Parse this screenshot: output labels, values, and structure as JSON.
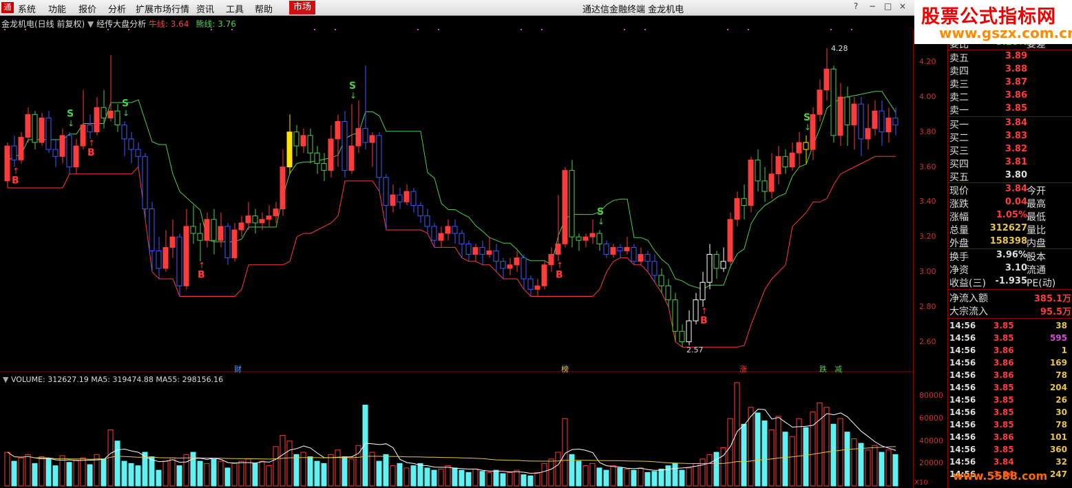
{
  "menubar": {
    "logo": "通",
    "items": [
      "系统",
      "功能",
      "报价",
      "分析",
      "扩展市场行情",
      "资讯",
      "工具",
      "帮助"
    ],
    "market_tab": "市场",
    "title": "通达信金融终端",
    "stock": "金龙机电",
    "window_buttons": [
      "?",
      "−",
      "□",
      "×"
    ]
  },
  "watermark": {
    "line1": "股票公式指标网",
    "line2": "www.gszx.com.cn",
    "bottom": "www.5588.com"
  },
  "chart_header": {
    "name": "金龙机电(日线 前复权)",
    "indicator": "经传大盘分析",
    "bull_label": "牛线:",
    "bull_value": "3.64",
    "bear_label": "熊线:",
    "bear_value": "3.76"
  },
  "volume_header": {
    "text": "VOLUME: 312627.19  MA5: 319474.88  MA55: 298156.16"
  },
  "events": [
    {
      "label": "财",
      "color": "#4aa3ff",
      "pos": 340
    },
    {
      "label": "榜",
      "color": "#e6c64a",
      "pos": 815
    },
    {
      "label": "涨",
      "color": "#ff3b3b",
      "pos": 1074
    },
    {
      "label": "跌",
      "color": "#4cd04c",
      "pos": 1190
    },
    {
      "label": "减",
      "color": "#4cd04c",
      "pos": 1212
    }
  ],
  "chart_data": {
    "type": "candlestick",
    "price_axis": {
      "min": 2.5,
      "max": 4.35,
      "ticks": [
        "4.20",
        "4.00",
        "3.80",
        "3.60",
        "3.40",
        "3.20",
        "3.00",
        "2.80",
        "2.60"
      ]
    },
    "volume_axis": {
      "max": 95000,
      "ticks": [
        "80000",
        "60000",
        "40000",
        "20000"
      ],
      "unit_label": "X10"
    },
    "high_label": "4.28",
    "low_label": "2.57",
    "signals": [
      {
        "type": "B",
        "index": 1
      },
      {
        "type": "S",
        "index": 9
      },
      {
        "type": "B",
        "index": 12
      },
      {
        "type": "S",
        "index": 17
      },
      {
        "type": "B",
        "index": 28
      },
      {
        "type": "S",
        "index": 50
      },
      {
        "type": "B",
        "index": 80
      },
      {
        "type": "S",
        "index": 86
      },
      {
        "type": "B",
        "index": 101
      },
      {
        "type": "S",
        "index": 116
      }
    ],
    "candles": [
      [
        3.52,
        3.72,
        3.74,
        3.48
      ],
      [
        3.72,
        3.64,
        3.78,
        3.6
      ],
      [
        3.64,
        3.77,
        3.8,
        3.62
      ],
      [
        3.77,
        3.9,
        3.94,
        3.74
      ],
      [
        3.9,
        3.74,
        3.92,
        3.7
      ],
      [
        3.74,
        3.88,
        3.91,
        3.72
      ],
      [
        3.88,
        3.7,
        3.92,
        3.68
      ],
      [
        3.7,
        3.66,
        3.76,
        3.6
      ],
      [
        3.66,
        3.78,
        3.82,
        3.62
      ],
      [
        3.78,
        3.6,
        3.8,
        3.56
      ],
      [
        3.6,
        3.72,
        3.76,
        3.56
      ],
      [
        3.72,
        3.84,
        4.04,
        3.7
      ],
      [
        3.84,
        3.8,
        3.9,
        3.76
      ],
      [
        3.8,
        3.94,
        4.0,
        3.78
      ],
      [
        3.94,
        3.88,
        4.04,
        3.82
      ],
      [
        3.88,
        3.92,
        4.24,
        3.86
      ],
      [
        3.92,
        3.84,
        3.96,
        3.8
      ],
      [
        3.84,
        3.76,
        3.86,
        3.66
      ],
      [
        3.76,
        3.7,
        3.8,
        3.62
      ],
      [
        3.7,
        3.66,
        3.74,
        3.6
      ],
      [
        3.66,
        3.36,
        3.68,
        3.3
      ],
      [
        3.36,
        3.12,
        3.4,
        3.0
      ],
      [
        3.12,
        3.02,
        3.2,
        2.96
      ],
      [
        3.02,
        3.14,
        3.24,
        3.0
      ],
      [
        3.14,
        3.2,
        3.3,
        3.08
      ],
      [
        3.2,
        2.92,
        3.22,
        2.86
      ],
      [
        2.92,
        3.26,
        3.36,
        2.9
      ],
      [
        3.26,
        3.22,
        3.38,
        3.16
      ],
      [
        3.22,
        3.18,
        3.28,
        3.06
      ],
      [
        3.18,
        3.3,
        3.34,
        3.14
      ],
      [
        3.3,
        3.18,
        3.36,
        3.1
      ],
      [
        3.18,
        3.26,
        3.34,
        3.14
      ],
      [
        3.26,
        3.08,
        3.28,
        3.04
      ],
      [
        3.08,
        3.24,
        3.28,
        3.06
      ],
      [
        3.24,
        3.28,
        3.32,
        3.2
      ],
      [
        3.28,
        3.32,
        3.4,
        3.24
      ],
      [
        3.32,
        3.28,
        3.36,
        3.22
      ],
      [
        3.28,
        3.3,
        3.34,
        3.24
      ],
      [
        3.3,
        3.32,
        3.38,
        3.26
      ],
      [
        3.32,
        3.36,
        3.4,
        3.28
      ],
      [
        3.36,
        3.6,
        3.7,
        3.32
      ],
      [
        3.6,
        3.8,
        3.9,
        3.56
      ],
      [
        3.8,
        3.72,
        3.84,
        3.66
      ],
      [
        3.72,
        3.78,
        3.82,
        3.68
      ],
      [
        3.78,
        3.68,
        3.82,
        3.62
      ],
      [
        3.68,
        3.62,
        3.72,
        3.56
      ],
      [
        3.62,
        3.58,
        3.68,
        3.52
      ],
      [
        3.58,
        3.76,
        3.84,
        3.54
      ],
      [
        3.76,
        3.86,
        3.9,
        3.6
      ],
      [
        3.86,
        3.58,
        3.92,
        3.54
      ],
      [
        3.58,
        3.72,
        3.96,
        3.56
      ],
      [
        3.72,
        3.82,
        3.98,
        3.68
      ],
      [
        3.82,
        3.74,
        4.18,
        3.7
      ],
      [
        3.74,
        3.78,
        3.8,
        3.6
      ],
      [
        3.78,
        3.54,
        3.8,
        3.46
      ],
      [
        3.54,
        3.38,
        3.56,
        3.24
      ],
      [
        3.38,
        3.44,
        3.5,
        3.34
      ],
      [
        3.44,
        3.4,
        3.48,
        3.36
      ],
      [
        3.4,
        3.46,
        3.5,
        3.38
      ],
      [
        3.46,
        3.38,
        3.48,
        3.34
      ],
      [
        3.38,
        3.32,
        3.4,
        3.28
      ],
      [
        3.32,
        3.26,
        3.36,
        3.22
      ],
      [
        3.26,
        3.18,
        3.28,
        3.14
      ],
      [
        3.18,
        3.22,
        3.26,
        3.14
      ],
      [
        3.22,
        3.26,
        3.3,
        3.18
      ],
      [
        3.26,
        3.22,
        3.3,
        3.16
      ],
      [
        3.22,
        3.16,
        3.24,
        3.08
      ],
      [
        3.16,
        3.1,
        3.18,
        3.06
      ],
      [
        3.1,
        3.14,
        3.16,
        3.06
      ],
      [
        3.14,
        3.1,
        3.18,
        3.04
      ],
      [
        3.1,
        3.12,
        3.2,
        3.08
      ],
      [
        3.12,
        3.06,
        3.16,
        3.0
      ],
      [
        3.06,
        3.02,
        3.08,
        2.96
      ],
      [
        3.02,
        3.04,
        3.08,
        2.98
      ],
      [
        3.04,
        3.08,
        3.12,
        3.0
      ],
      [
        3.08,
        2.96,
        3.1,
        2.9
      ],
      [
        2.96,
        2.9,
        2.98,
        2.86
      ],
      [
        2.9,
        2.92,
        2.96,
        2.86
      ],
      [
        2.92,
        3.04,
        3.06,
        2.9
      ],
      [
        3.04,
        3.1,
        3.14,
        3.0
      ],
      [
        3.1,
        3.16,
        3.44,
        3.06
      ],
      [
        3.16,
        3.58,
        3.6,
        3.14
      ],
      [
        3.58,
        3.2,
        3.64,
        3.14
      ],
      [
        3.2,
        3.18,
        3.22,
        3.12
      ],
      [
        3.18,
        3.2,
        3.22,
        3.14
      ],
      [
        3.2,
        3.22,
        3.3,
        3.16
      ],
      [
        3.22,
        3.16,
        3.24,
        3.12
      ],
      [
        3.16,
        3.1,
        3.18,
        3.08
      ],
      [
        3.1,
        3.14,
        3.16,
        3.08
      ],
      [
        3.14,
        3.12,
        3.16,
        3.08
      ],
      [
        3.12,
        3.14,
        3.2,
        3.1
      ],
      [
        3.14,
        3.06,
        3.16,
        3.04
      ],
      [
        3.06,
        3.1,
        3.14,
        3.04
      ],
      [
        3.1,
        3.06,
        3.12,
        3.0
      ],
      [
        3.06,
        2.98,
        3.1,
        2.94
      ],
      [
        2.98,
        2.92,
        3.02,
        2.88
      ],
      [
        2.92,
        2.84,
        2.96,
        2.8
      ],
      [
        2.84,
        2.66,
        2.88,
        2.6
      ],
      [
        2.66,
        2.6,
        2.7,
        2.57
      ],
      [
        2.6,
        2.72,
        2.78,
        2.58
      ],
      [
        2.72,
        2.84,
        2.88,
        2.7
      ],
      [
        2.84,
        2.94,
        3.0,
        2.8
      ],
      [
        2.94,
        3.1,
        3.16,
        2.9
      ],
      [
        3.1,
        3.02,
        3.12,
        2.96
      ],
      [
        3.02,
        3.06,
        3.14,
        3.0
      ],
      [
        3.06,
        3.3,
        3.34,
        3.04
      ],
      [
        3.3,
        3.42,
        3.46,
        3.26
      ],
      [
        3.42,
        3.38,
        3.5,
        3.3
      ],
      [
        3.38,
        3.64,
        3.66,
        3.34
      ],
      [
        3.64,
        3.52,
        3.7,
        3.46
      ],
      [
        3.52,
        3.46,
        3.6,
        3.4
      ],
      [
        3.46,
        3.56,
        3.68,
        3.42
      ],
      [
        3.56,
        3.66,
        3.72,
        3.5
      ],
      [
        3.66,
        3.6,
        3.7,
        3.56
      ],
      [
        3.6,
        3.68,
        3.74,
        3.58
      ],
      [
        3.68,
        3.74,
        3.8,
        3.6
      ],
      [
        3.74,
        3.7,
        3.78,
        3.62
      ],
      [
        3.7,
        3.9,
        3.94,
        3.64
      ],
      [
        3.9,
        4.04,
        4.1,
        3.86
      ],
      [
        4.04,
        4.16,
        4.28,
        3.98
      ],
      [
        4.16,
        3.78,
        4.18,
        3.74
      ],
      [
        3.78,
        4.0,
        4.08,
        3.72
      ],
      [
        4.0,
        3.84,
        4.06,
        3.72
      ],
      [
        3.84,
        3.96,
        4.0,
        3.7
      ],
      [
        3.96,
        3.76,
        4.0,
        3.66
      ],
      [
        3.76,
        3.82,
        3.96,
        3.7
      ],
      [
        3.82,
        3.92,
        3.98,
        3.78
      ],
      [
        3.92,
        3.8,
        3.98,
        3.72
      ],
      [
        3.8,
        3.88,
        3.94,
        3.74
      ],
      [
        3.88,
        3.84,
        3.94,
        3.78
      ]
    ],
    "volume": [
      30000,
      22000,
      25000,
      28000,
      20000,
      26000,
      24000,
      18000,
      27000,
      21000,
      23000,
      25000,
      19000,
      28000,
      24000,
      50000,
      40000,
      22000,
      20000,
      18000,
      30000,
      26000,
      14000,
      22000,
      25000,
      18000,
      28000,
      30000,
      22000,
      20000,
      24000,
      22000,
      16000,
      20000,
      22000,
      24000,
      20000,
      22000,
      18000,
      35000,
      45000,
      40000,
      28000,
      30000,
      26000,
      22000,
      20000,
      28000,
      32000,
      26000,
      24000,
      36000,
      72000,
      30000,
      22000,
      28000,
      18000,
      20000,
      16000,
      18000,
      20000,
      16000,
      14000,
      15000,
      18000,
      16000,
      14000,
      12000,
      15000,
      13000,
      12000,
      14000,
      11000,
      12000,
      14000,
      10000,
      9000,
      12000,
      20000,
      24000,
      30000,
      60000,
      28000,
      22000,
      18000,
      20000,
      16000,
      14000,
      18000,
      16000,
      15000,
      14000,
      16000,
      12000,
      13000,
      15000,
      18000,
      20000,
      14000,
      16000,
      20000,
      24000,
      28000,
      30000,
      34000,
      60000,
      92000,
      55000,
      70000,
      65000,
      58000,
      50000,
      62000,
      48000,
      44000,
      60000,
      52000,
      66000,
      74000,
      70000,
      55000,
      60000,
      48000,
      42000,
      38000,
      32000,
      36000,
      30000,
      32000,
      28000
    ],
    "series": [
      {
        "name": "牛线",
        "color": "#ff3b3b"
      },
      {
        "name": "熊线",
        "color": "#4cd04c"
      }
    ]
  },
  "quote_panel": {
    "top_partial": {
      "label": "委比",
      "value": "3.28%",
      "label2": "委差"
    },
    "asks": [
      {
        "label": "卖五",
        "price": "3.89"
      },
      {
        "label": "卖四",
        "price": "3.88"
      },
      {
        "label": "卖三",
        "price": "3.87"
      },
      {
        "label": "卖二",
        "price": "3.86"
      },
      {
        "label": "卖一",
        "price": "3.85"
      }
    ],
    "bids": [
      {
        "label": "买一",
        "price": "3.84"
      },
      {
        "label": "买二",
        "price": "3.83"
      },
      {
        "label": "买三",
        "price": "3.82"
      },
      {
        "label": "买四",
        "price": "3.81"
      },
      {
        "label": "买五",
        "price": "3.80"
      }
    ],
    "stats": [
      {
        "label": "现价",
        "value": "3.84",
        "label2": "今开"
      },
      {
        "label": "涨跌",
        "value": "0.04",
        "label2": "最高"
      },
      {
        "label": "涨幅",
        "value": "1.05%",
        "label2": "最低"
      },
      {
        "label": "总量",
        "value": "312627",
        "label2": "量比"
      },
      {
        "label": "外盘",
        "value": "158398",
        "label2": "内盘"
      }
    ],
    "stats2": [
      {
        "label": "换手",
        "value": "3.96%",
        "label2": "股本"
      },
      {
        "label": "净资",
        "value": "3.10",
        "label2": "流通"
      },
      {
        "label": "收益(三)",
        "value": "-1.935",
        "label2": "PE(动)"
      }
    ],
    "flows": [
      {
        "label": "净流入额",
        "value": "385.1万"
      },
      {
        "label": "大宗流入",
        "value": "95.5万"
      }
    ],
    "trades": [
      {
        "time": "14:56",
        "price": "3.85",
        "vol": "38",
        "color": "#e6c64a"
      },
      {
        "time": "14:56",
        "price": "3.85",
        "vol": "595",
        "color": "#d94ad9"
      },
      {
        "time": "14:56",
        "price": "3.86",
        "vol": "1",
        "color": "#e6c64a"
      },
      {
        "time": "14:56",
        "price": "3.86",
        "vol": "169",
        "color": "#e6c64a"
      },
      {
        "time": "14:56",
        "price": "3.86",
        "vol": "78",
        "color": "#e6c64a"
      },
      {
        "time": "14:56",
        "price": "3.85",
        "vol": "204",
        "color": "#e6c64a"
      },
      {
        "time": "14:56",
        "price": "3.85",
        "vol": "26",
        "color": "#e6c64a"
      },
      {
        "time": "14:56",
        "price": "3.85",
        "vol": "30",
        "color": "#e6c64a"
      },
      {
        "time": "14:56",
        "price": "3.85",
        "vol": "78",
        "color": "#e6c64a"
      },
      {
        "time": "14:56",
        "price": "3.86",
        "vol": "101",
        "color": "#e6c64a"
      },
      {
        "time": "14:56",
        "price": "3.85",
        "vol": "360",
        "color": "#e6c64a"
      },
      {
        "time": "14:56",
        "price": "3.84",
        "vol": "32",
        "color": "#e6c64a"
      },
      {
        "time": "14:56",
        "price": "3.84",
        "vol": "247",
        "color": "#e6c64a"
      }
    ]
  }
}
